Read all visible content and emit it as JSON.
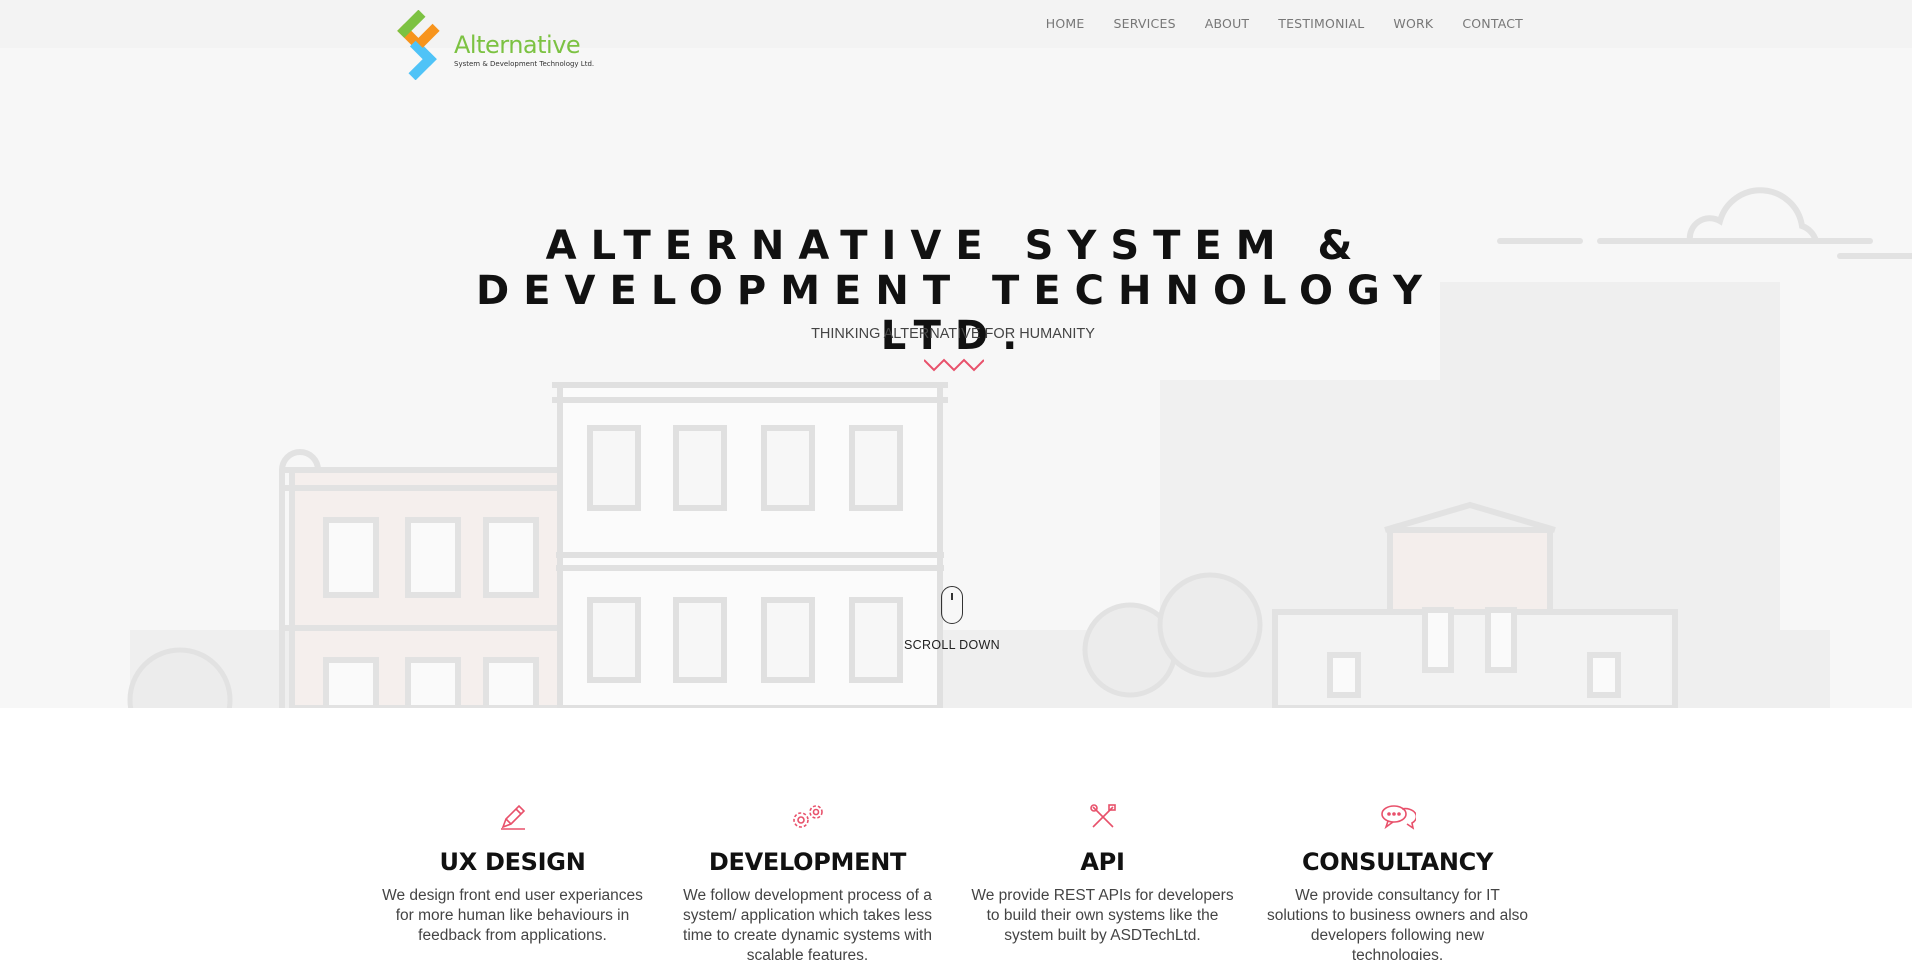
{
  "brand": {
    "name": "Alternative",
    "tagline": "System & Development Technology Ltd.",
    "colors": {
      "green": "#7cc242",
      "orange": "#f7941d",
      "blue": "#4fc3f7",
      "accent": "#e8516b"
    }
  },
  "nav": {
    "items": [
      {
        "label": "HOME"
      },
      {
        "label": "SERVICES"
      },
      {
        "label": "ABOUT"
      },
      {
        "label": "TESTIMONIAL"
      },
      {
        "label": "WORK"
      },
      {
        "label": "CONTACT"
      }
    ]
  },
  "hero": {
    "title": "ALTERNATIVE SYSTEM & DEVELOPMENT TECHNOLOGY LTD.",
    "subtitle": "THINKING ALTERNATIVE FOR HUMANITY",
    "scroll_label": "SCROLL DOWN",
    "divider_icon": "zigzag-icon",
    "scroll_icon": "mouse-icon"
  },
  "services": [
    {
      "icon": "pencil-icon",
      "title": "UX DESIGN",
      "text": "We design front end user experiances for more human like behaviours in feedback from applications."
    },
    {
      "icon": "gears-icon",
      "title": "DEVELOPMENT",
      "text": "We follow development process of a system/ application which takes less time to create dynamic systems with scalable features."
    },
    {
      "icon": "tools-icon",
      "title": "API",
      "text": "We provide REST APIs for developers to build their own systems like the system built by ASDTechLtd."
    },
    {
      "icon": "chat-bubbles-icon",
      "title": "CONSULTANCY",
      "text": "We provide consultancy for IT solutions to business owners and also developers following new technologies."
    }
  ]
}
